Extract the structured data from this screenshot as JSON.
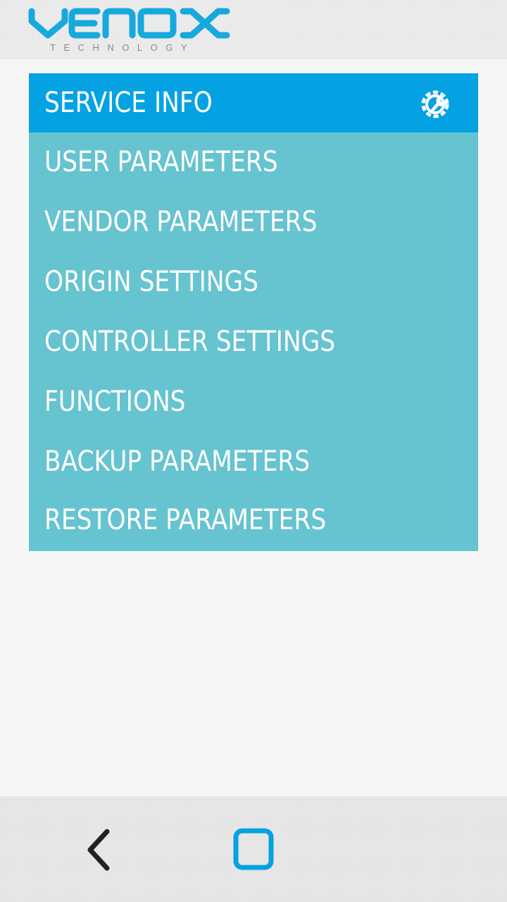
{
  "brand": {
    "name": "VENOX",
    "tagline": "TECHNOLOGY",
    "accent_color": "#05a2e3",
    "logo_color": "#16a9dd"
  },
  "menu": {
    "item_color": "#66c3d0",
    "active_color": "#05a2e3",
    "items": [
      {
        "label": "SERVICE INFO",
        "active": true,
        "icon": "wrench-gear-icon"
      },
      {
        "label": "USER PARAMETERS"
      },
      {
        "label": "VENDOR PARAMETERS"
      },
      {
        "label": "ORIGIN SETTINGS"
      },
      {
        "label": "CONTROLLER SETTINGS"
      },
      {
        "label": "FUNCTIONS"
      },
      {
        "label": "BACKUP PARAMETERS"
      },
      {
        "label": "RESTORE PARAMETERS"
      }
    ]
  },
  "navbar": {
    "back_icon": "back-chevron-icon",
    "home_icon": "home-square-icon"
  }
}
